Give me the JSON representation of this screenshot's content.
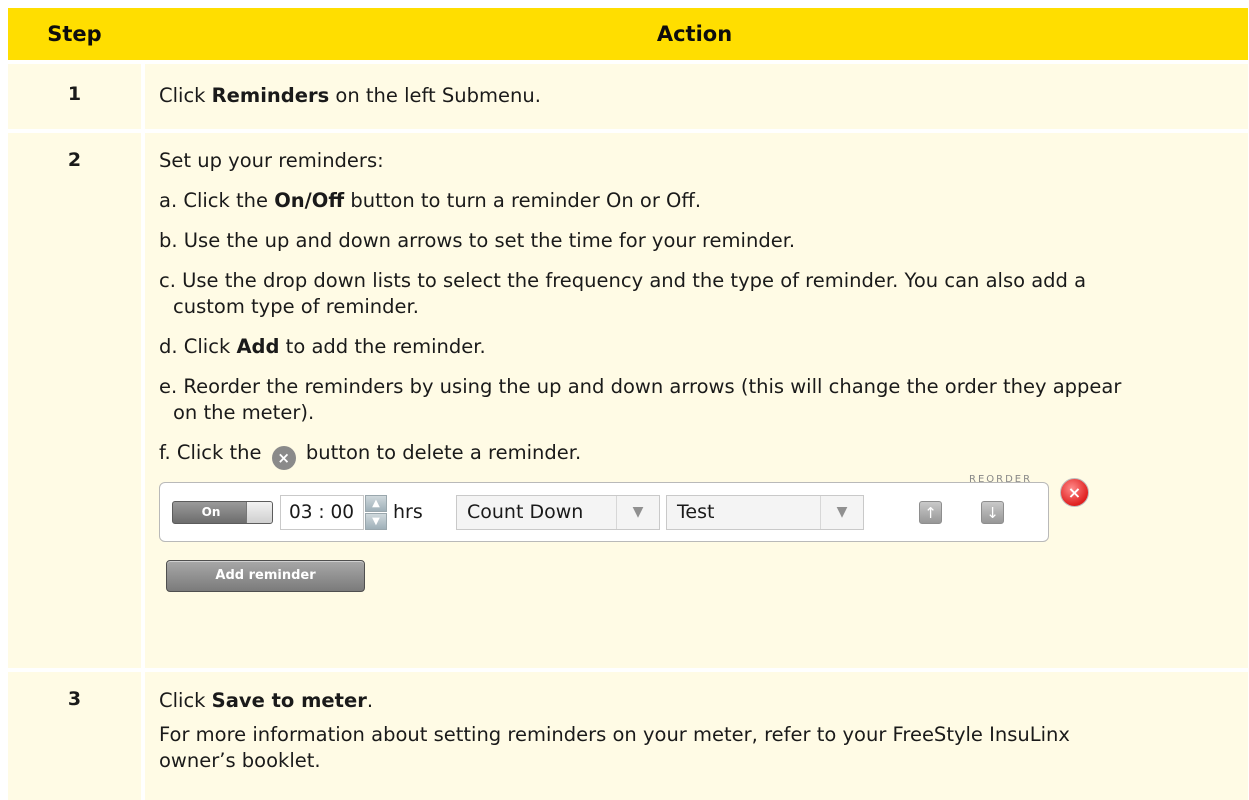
{
  "header": {
    "step": "Step",
    "action": "Action"
  },
  "steps": [
    {
      "num": "1",
      "lines": [
        {
          "pre": "Click ",
          "bold": "Reminders",
          "post": " on the left Submenu."
        }
      ]
    },
    {
      "num": "2",
      "intro": "Set up your reminders:",
      "a": {
        "pre": "a. Click the ",
        "bold": "On/Off",
        "post": " button to turn a reminder On or Off."
      },
      "b": "b. Use the up and down arrows to set the time for your reminder.",
      "c1": "c. Use the drop down lists to select the frequency and the type of reminder. You can also add a",
      "c2": "custom type of reminder.",
      "d": {
        "pre": "d. Click ",
        "bold": "Add",
        "post": " to add the reminder."
      },
      "e1": "e. Reorder the reminders by using the up and down arrows (this will change the order they appear",
      "e2": "on the meter).",
      "f": {
        "pre": "f. Click the ",
        "icon": "×",
        "post": " button to delete a reminder."
      }
    },
    {
      "num": "3",
      "save": {
        "pre": "Click ",
        "bold": "Save to meter",
        "post": "."
      },
      "info1": "For more information about setting reminders on your meter, refer to your FreeStyle InsuLinx",
      "info2": "owner’s booklet."
    }
  ],
  "widget": {
    "reorder_label": "REORDER",
    "toggle_label": "On",
    "time": "03 : 00",
    "spin_up": "▲",
    "spin_down": "▼",
    "hrs": "hrs",
    "frequency": "Count Down",
    "type": "Test",
    "dropdown_arrow": "▼",
    "up_arrow": "↑",
    "down_arrow": "↓",
    "delete_glyph": "×",
    "add_button": "Add reminder"
  }
}
